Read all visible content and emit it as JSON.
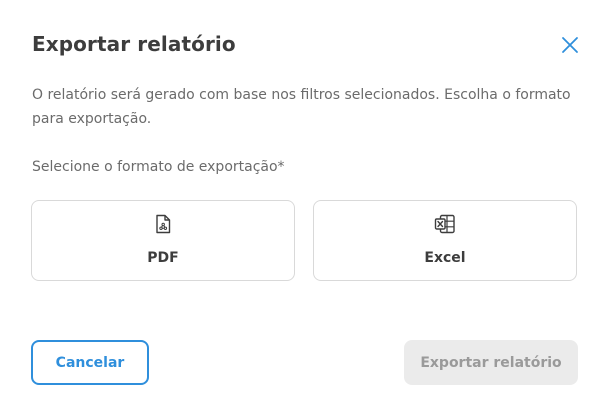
{
  "dialog": {
    "title": "Exportar relatório",
    "description": "O relatório será gerado com base nos filtros selecionados. Escolha o formato para exportação.",
    "field_label": "Selecione o formato de exportação*",
    "close_icon": "close-icon"
  },
  "formats": [
    {
      "label": "PDF",
      "icon": "pdf-file-icon"
    },
    {
      "label": "Excel",
      "icon": "excel-file-icon"
    }
  ],
  "actions": {
    "cancel_label": "Cancelar",
    "export_label": "Exportar relatório",
    "export_enabled": false
  },
  "colors": {
    "accent": "#2f8fdc",
    "title_text": "#3d3d3d",
    "body_text": "#6b6b6b",
    "disabled_bg": "#ebebeb",
    "disabled_text": "#9a9a9a",
    "border": "#d9d9d9"
  }
}
